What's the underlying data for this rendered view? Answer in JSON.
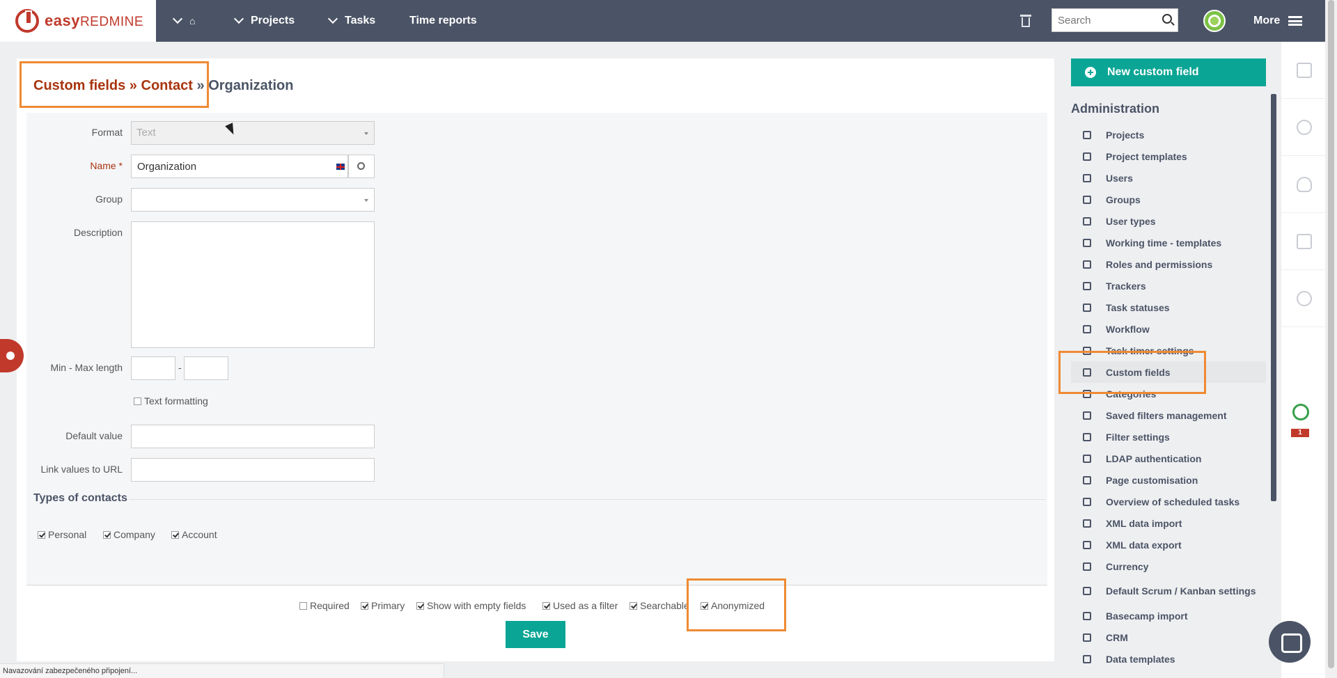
{
  "app": {
    "logo_main": "easy",
    "logo_sub": "REDMINE"
  },
  "topnav": {
    "projects": "Projects",
    "tasks": "Tasks",
    "time_reports": "Time reports",
    "search_placeholder": "Search",
    "more": "More"
  },
  "breadcrumb": {
    "custom_fields": "Custom fields",
    "sep1": " » ",
    "contact": "Contact",
    "sep2": " » ",
    "current": "Organization"
  },
  "form": {
    "format_label": "Format",
    "format_value": "Text",
    "name_label": "Name *",
    "name_value": "Organization",
    "group_label": "Group",
    "group_value": "",
    "description_label": "Description",
    "description_value": "",
    "minmax_label": "Min - Max length",
    "minmax_sep": "-",
    "text_formatting_label": "Text formatting",
    "default_value_label": "Default value",
    "link_values_label": "Link values to URL"
  },
  "types_of_contacts": {
    "title": "Types of contacts",
    "items": [
      {
        "label": "Personal",
        "checked": true
      },
      {
        "label": "Company",
        "checked": true
      },
      {
        "label": "Account",
        "checked": true
      }
    ]
  },
  "options": [
    {
      "label": "Required",
      "checked": false
    },
    {
      "label": "Primary",
      "checked": true
    },
    {
      "label": "Show with empty fields",
      "checked": true
    },
    {
      "label": "Used as a filter",
      "checked": true
    },
    {
      "label": "Searchable",
      "checked": true
    },
    {
      "label": "Anonymized",
      "checked": true
    }
  ],
  "save_label": "Save",
  "sidebar": {
    "new_button": "New custom field",
    "title": "Administration",
    "items": [
      "Projects",
      "Project templates",
      "Users",
      "Groups",
      "User types",
      "Working time - templates",
      "Roles and permissions",
      "Trackers",
      "Task statuses",
      "Workflow",
      "Task timer settings",
      "Custom fields",
      "Categories",
      "Saved filters management",
      "Filter settings",
      "LDAP authentication",
      "Page customisation",
      "Overview of scheduled tasks",
      "XML data import",
      "XML data export",
      "Currency",
      "Default Scrum / Kanban settings",
      "Basecamp import",
      "CRM",
      "Data templates"
    ],
    "active": "Custom fields"
  },
  "right_strip": {
    "badge": "1"
  },
  "status_bar": "Navazování zabezpečeného připojení...",
  "colors": {
    "accent": "#0aa595",
    "brand": "#c0392b",
    "topbar": "#4b5466",
    "highlight": "#ef8a33"
  }
}
